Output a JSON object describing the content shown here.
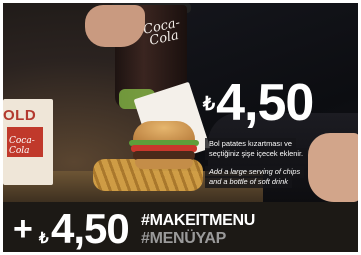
{
  "ad": {
    "cup_brand": "Coca-Cola",
    "box_brand": "OLD",
    "box_drink_label": "Coca-Cola",
    "price_top": {
      "currency": "₺",
      "amount": "4,50"
    },
    "caption_tr": [
      "Bol patates kızartması ve",
      "seçtiğiniz şişe içecek eklenir."
    ],
    "caption_en": [
      "Add a large serving of chips",
      "and a bottle of soft drink"
    ],
    "bottom_bar": {
      "plus": "+",
      "currency": "₺",
      "amount": "4,50",
      "hashtag_en": "#MAKEITMENU",
      "hashtag_tr": "#MENÜYAP"
    }
  },
  "colors": {
    "bar_background": "#1c1915",
    "text_primary": "#ffffff",
    "hashtag_secondary": "#9a9a9a",
    "caption_background": "#141418"
  }
}
